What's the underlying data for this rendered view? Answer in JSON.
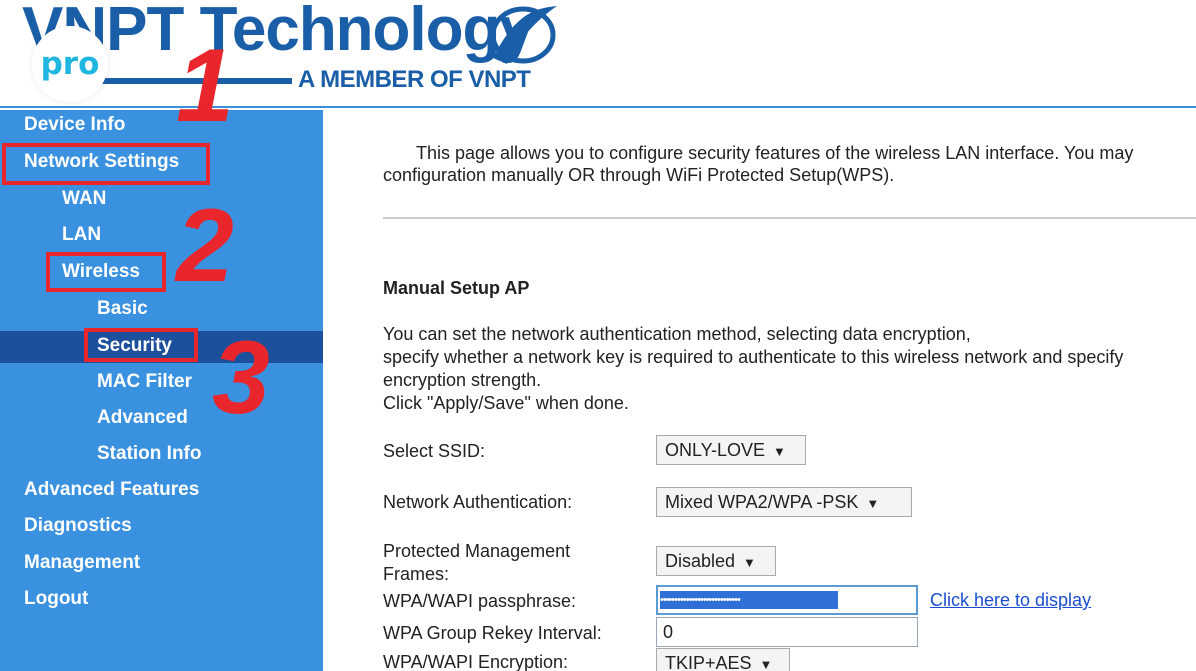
{
  "header": {
    "brand": "VNPT Technology",
    "tagline": "A MEMBER OF VNPT",
    "badge": "pro"
  },
  "sidebar": {
    "items": [
      {
        "label": "Device Info"
      },
      {
        "label": "Network Settings"
      },
      {
        "label": "WAN"
      },
      {
        "label": "LAN"
      },
      {
        "label": "Wireless"
      },
      {
        "label": "Basic"
      },
      {
        "label": "Security"
      },
      {
        "label": "MAC Filter"
      },
      {
        "label": "Advanced"
      },
      {
        "label": "Station Info"
      },
      {
        "label": "Advanced Features"
      },
      {
        "label": "Diagnostics"
      },
      {
        "label": "Management"
      },
      {
        "label": "Logout"
      }
    ],
    "selected": "Security"
  },
  "annotations": {
    "step1": "1",
    "step2": "2",
    "step3": "3",
    "color": "#e8262c"
  },
  "main": {
    "intro_line1": "This page allows you to configure security features of the wireless LAN interface. You may",
    "intro_line2": "configuration manually OR through WiFi Protected Setup(WPS).",
    "section_title": "Manual Setup AP",
    "desc_line1": "You can set the network authentication method, selecting data encryption,",
    "desc_line2": "specify whether a network key is required to authenticate to this wireless network and specify",
    "desc_line3": "encryption strength.",
    "desc_line4": "Click \"Apply/Save\" when done.",
    "form": {
      "ssid_label": "Select SSID:",
      "ssid_value": "ONLY-LOVE",
      "auth_label": "Network Authentication:",
      "auth_value": "Mixed WPA2/WPA -PSK",
      "pmf_label_line1": "Protected Management",
      "pmf_label_line2": "Frames:",
      "pmf_value": "Disabled",
      "passphrase_label": "WPA/WAPI passphrase:",
      "passphrase_mask": "••••••••••••••••••••••••••••",
      "display_link": "Click here to display",
      "rekey_label": "WPA Group Rekey Interval:",
      "rekey_value": "0",
      "encryption_label": "WPA/WAPI Encryption:",
      "encryption_value": "TKIP+AES"
    }
  },
  "icons": {
    "dropdown": "▼"
  }
}
